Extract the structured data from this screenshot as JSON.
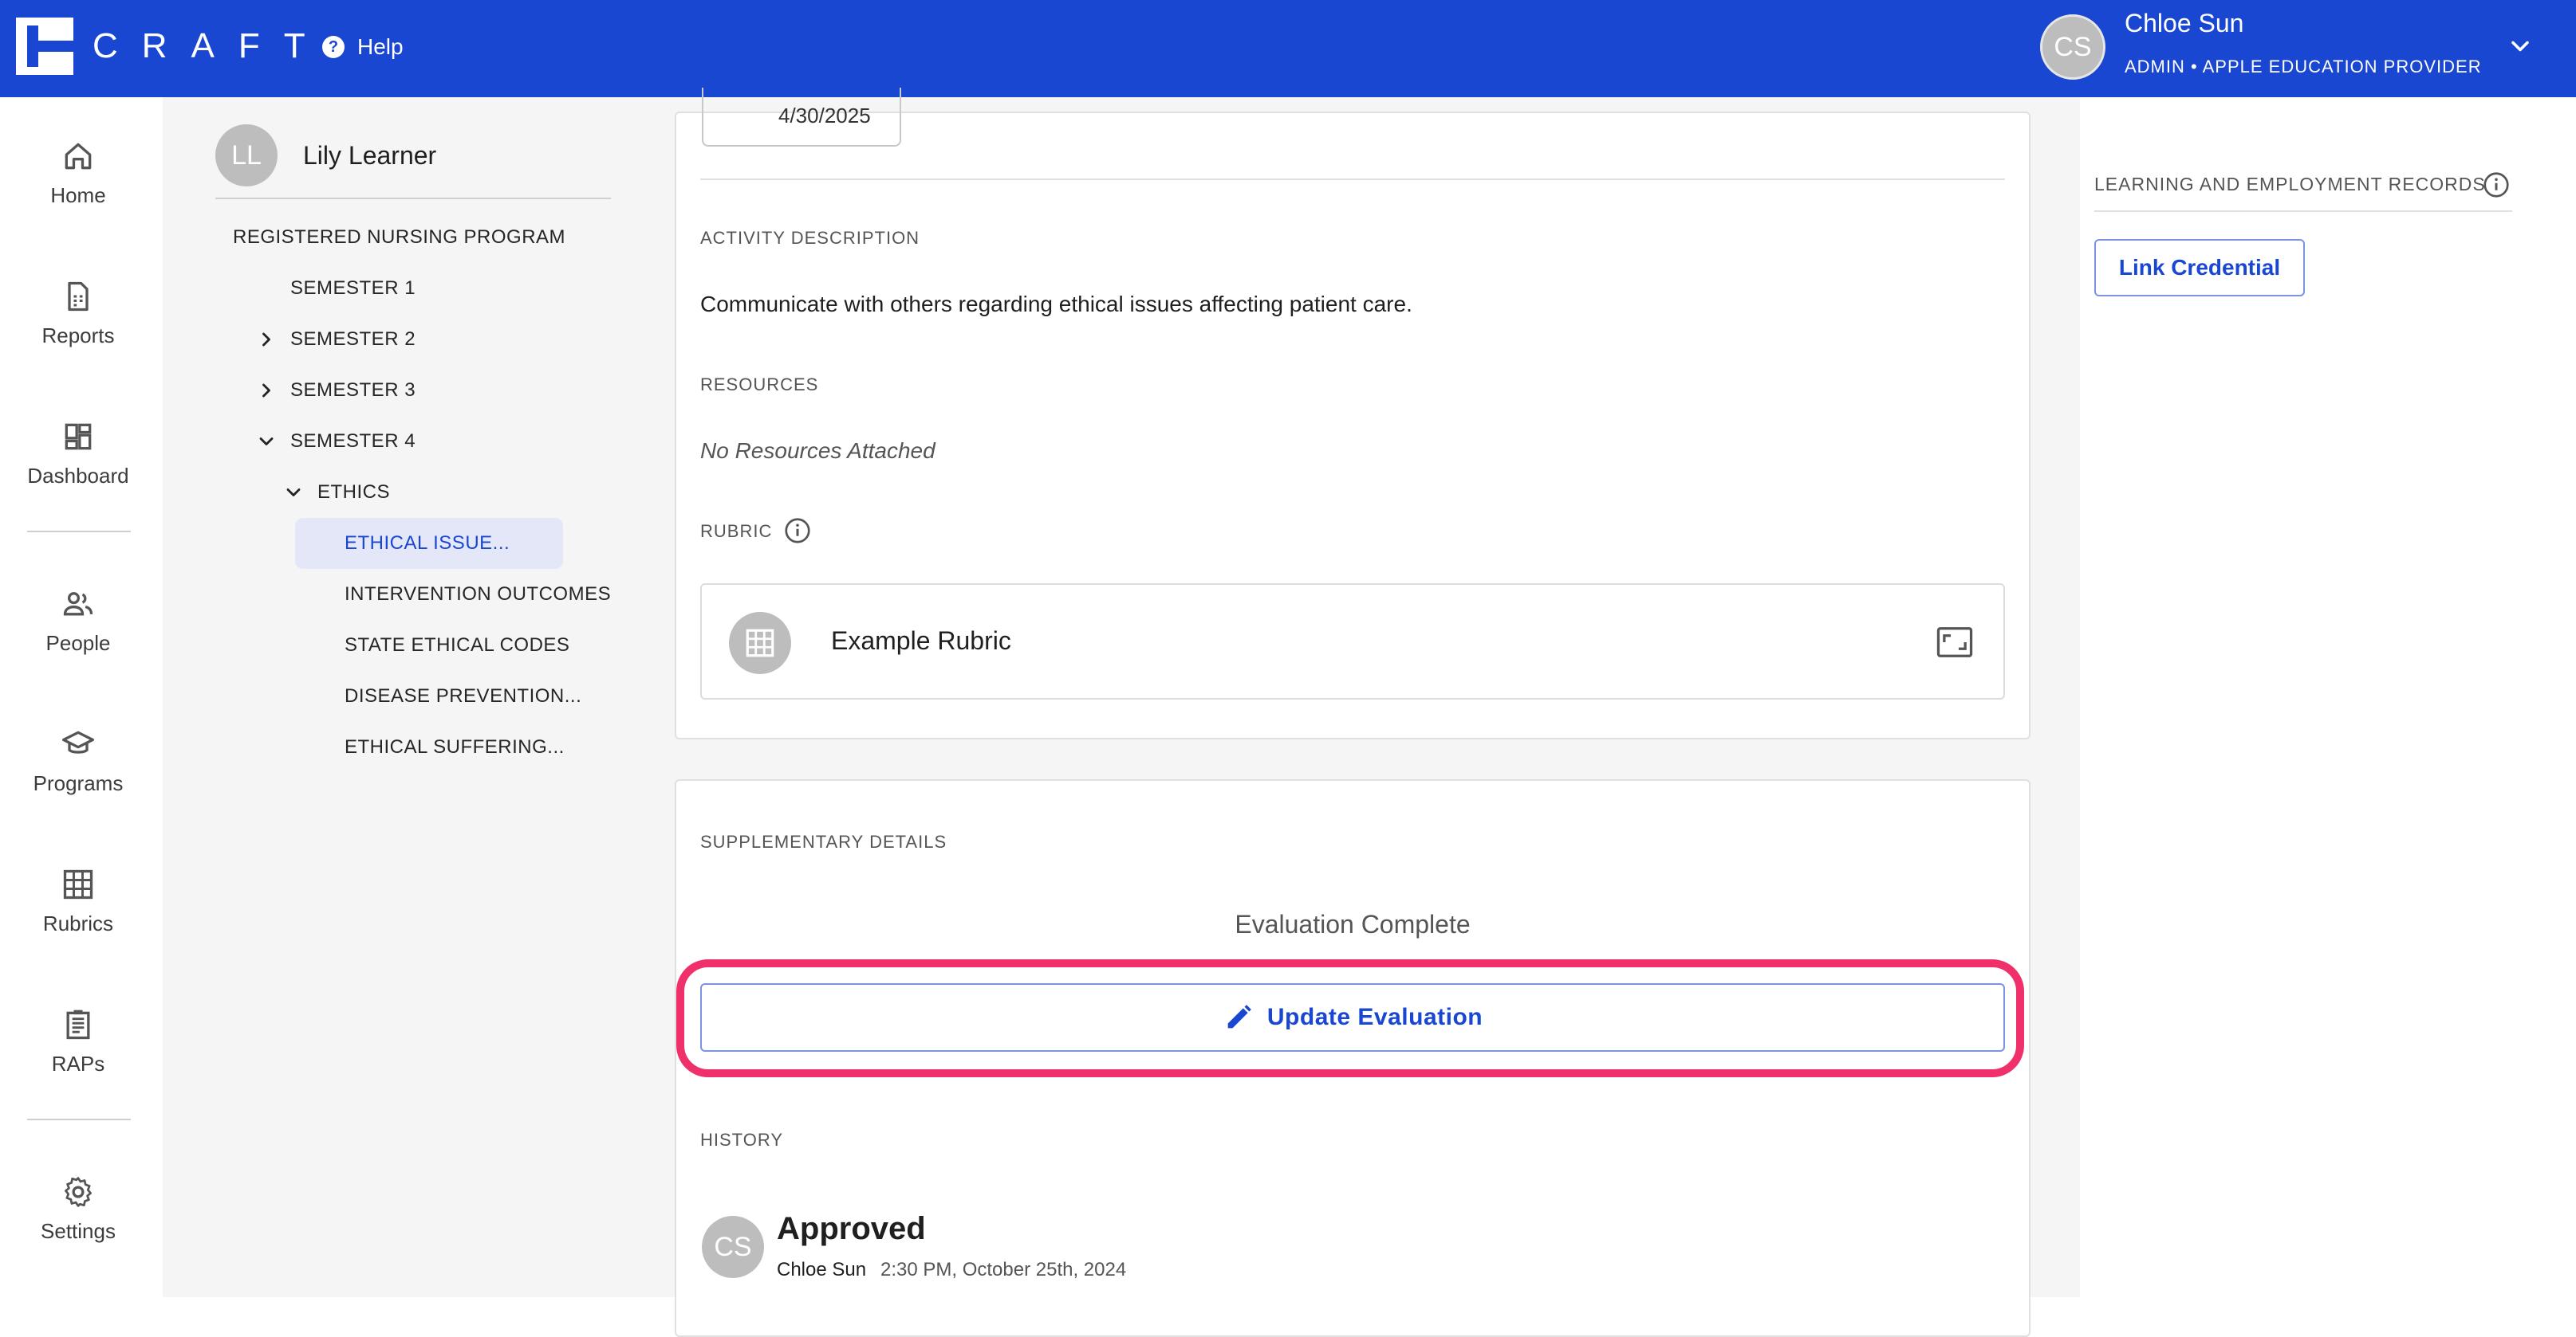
{
  "app": {
    "logo_text": "CRAFT",
    "help_label": "Help"
  },
  "user": {
    "initials": "CS",
    "name": "Chloe Sun",
    "role": "ADMIN • APPLE EDUCATION PROVIDER"
  },
  "nav": {
    "home": "Home",
    "reports": "Reports",
    "dashboard": "Dashboard",
    "people": "People",
    "programs": "Programs",
    "rubrics": "Rubrics",
    "raps": "RAPs",
    "settings": "Settings"
  },
  "learner": {
    "initials": "LL",
    "name": "Lily Learner"
  },
  "tree": {
    "program": "REGISTERED NURSING PROGRAM",
    "semester1": "SEMESTER 1",
    "semester2": "SEMESTER 2",
    "semester3": "SEMESTER 3",
    "semester4": "SEMESTER 4",
    "ethics": "ETHICS",
    "ethical_issue": "ETHICAL ISSUE...",
    "intervention_outcomes": "INTERVENTION OUTCOMES",
    "state_ethical_codes": "STATE ETHICAL CODES",
    "disease_prevention": "DISEASE PREVENTION...",
    "ethical_suffering": "ETHICAL SUFFERING..."
  },
  "activity": {
    "date_partial": "4/30/2025",
    "description_label": "ACTIVITY DESCRIPTION",
    "description": "Communicate with others regarding ethical issues affecting patient care.",
    "resources_label": "RESOURCES",
    "resources_empty": "No Resources Attached",
    "rubric_label": "RUBRIC",
    "rubric_name": "Example Rubric"
  },
  "supplementary": {
    "label": "SUPPLEMENTARY DETAILS",
    "status": "Evaluation Complete",
    "update_button": "Update Evaluation",
    "history_label": "HISTORY",
    "history": [
      {
        "initials": "CS",
        "status": "Approved",
        "author": "Chloe Sun",
        "time": "2:30 PM, October 25th, 2024"
      }
    ]
  },
  "right": {
    "ler_label": "LEARNING AND EMPLOYMENT RECORDS",
    "link_button": "Link Credential"
  },
  "colors": {
    "brand": "#1a47d2",
    "highlight": "#f0306a",
    "selected_bg": "#e4e7f8"
  }
}
